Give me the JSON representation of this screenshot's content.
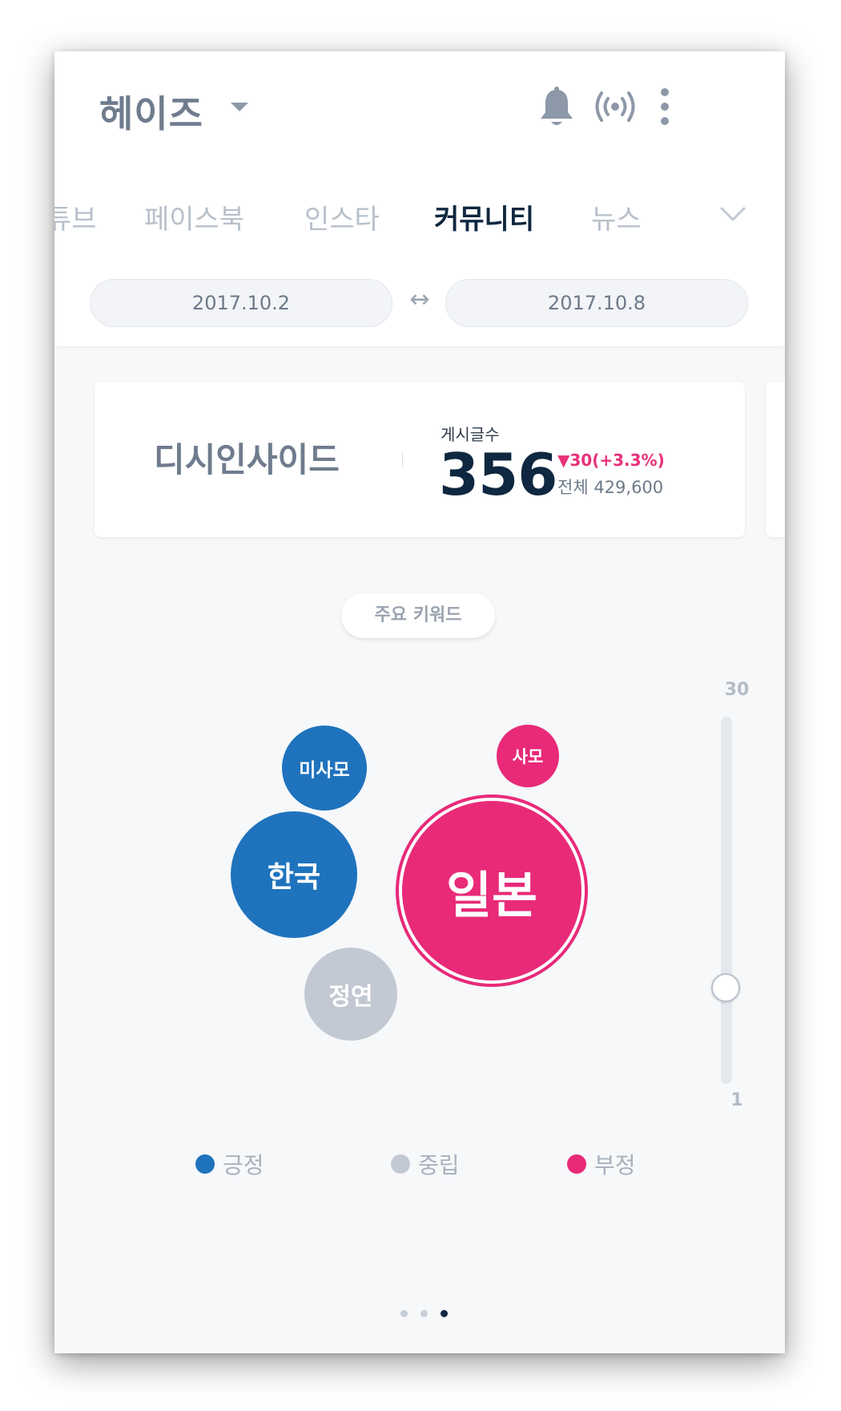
{
  "header": {
    "title": "헤이즈",
    "icons": [
      "caret-down-icon",
      "bell-icon",
      "broadcast-icon",
      "more-vertical-icon"
    ]
  },
  "tabs": [
    {
      "label": "튜브",
      "active": false
    },
    {
      "label": "페이스북",
      "active": false
    },
    {
      "label": "인스타",
      "active": false
    },
    {
      "label": "커뮤니티",
      "active": true
    },
    {
      "label": "뉴스",
      "active": false
    }
  ],
  "date_range": {
    "start": "2017.10.2",
    "separator": "↔",
    "end": "2017.10.8"
  },
  "summary_card": {
    "source": "디시인사이드",
    "metric_label": "게시글수",
    "metric_value": "356",
    "change": "▼30(+3.3%)",
    "total": "전체 429,600"
  },
  "keyword_section": {
    "title": "주요 키워드",
    "slider_max": "30",
    "slider_min": "1",
    "bubbles": [
      {
        "label": "미사모",
        "sentiment": "positive"
      },
      {
        "label": "한국",
        "sentiment": "positive"
      },
      {
        "label": "정연",
        "sentiment": "neutral"
      },
      {
        "label": "사모",
        "sentiment": "negative"
      },
      {
        "label": "일본",
        "sentiment": "negative"
      }
    ],
    "legend": [
      {
        "label": "긍정",
        "color": "#1f73bd"
      },
      {
        "label": "중립",
        "color": "#c3c9d2"
      },
      {
        "label": "부정",
        "color": "#e82a79"
      }
    ]
  },
  "pager": {
    "count": 3,
    "active_index": 2
  },
  "colors": {
    "positive": "#1f73bd",
    "neutral": "#c3c9d2",
    "negative": "#e82a79",
    "accent_dark": "#0f2740"
  }
}
